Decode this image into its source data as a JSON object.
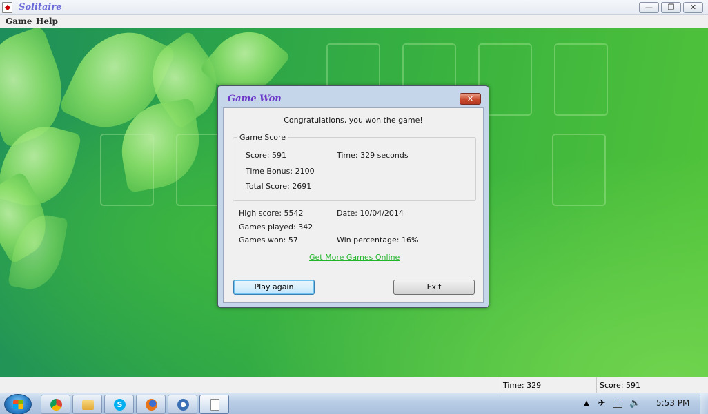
{
  "window": {
    "title": "Solitaire",
    "controls": {
      "minimize": "—",
      "maximize": "❐",
      "close": "✕"
    }
  },
  "menu": {
    "items": [
      "Game",
      "Help"
    ]
  },
  "dialog": {
    "title": "Game Won",
    "close_glyph": "✕",
    "congrats": "Congratulations, you won the game!",
    "group_label": "Game Score",
    "score": "Score: 591",
    "time": "Time:  329 seconds",
    "time_bonus": "Time Bonus: 2100",
    "total_score": "Total Score: 2691",
    "high_score": "High score: 5542",
    "date": "Date: 10/04/2014",
    "games_played": "Games played: 342",
    "games_won": "Games won: 57",
    "win_percentage": "Win percentage: 16%",
    "link": "Get More Games Online",
    "play_again": "Play again",
    "exit": "Exit"
  },
  "statusbar": {
    "time": "Time:  329",
    "score": "Score: 591"
  },
  "taskbar": {
    "apps": [
      "chrome-icon",
      "file-explorer-icon",
      "skype-icon",
      "firefox-icon",
      "itunes-icon",
      "solitaire-icon"
    ],
    "clock": "5:53 PM",
    "colors": {
      "chrome": "#e0402a",
      "skype": "#00aff0",
      "firefox": "#e8751a",
      "itunes": "#3a6fb5"
    }
  }
}
